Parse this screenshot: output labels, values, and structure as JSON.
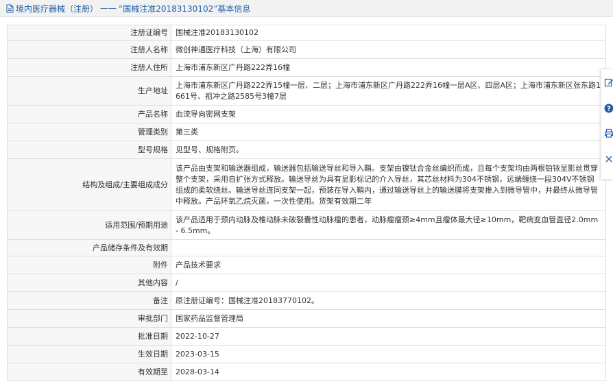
{
  "header": {
    "section": "境内医疗器械（注册）",
    "separator": "——",
    "title": "“国械注准20183130102”基本信息"
  },
  "rows": [
    {
      "label": "注册证编号",
      "value": "国械注准20183130102"
    },
    {
      "label": "注册人名称",
      "value": "微创神通医疗科技（上海）有限公司"
    },
    {
      "label": "注册人住所",
      "value": "上海市浦东新区广丹路222弄16幢"
    },
    {
      "label": "生产地址",
      "value": "上海市浦东新区广丹路222弄15幢一层、二层；上海市浦东新区广丹路222弄16幢一层A区、四层A区；上海市浦东新区张东路1661号、祖冲之路2585号3幢7层"
    },
    {
      "label": "产品名称",
      "value": "血流导向密网支架"
    },
    {
      "label": "管理类别",
      "value": "第三类"
    },
    {
      "label": "型号规格",
      "value": "见型号、规格附页。"
    },
    {
      "label": "结构及组成/主要组成成分",
      "value": "该产品由支架和输送器组成，输送器包括输送导丝和导入鞘。支架由镍钛合金丝编织而成，且每个支架均由两根铂铱显影丝贯穿整个支架，采用自扩张方式释放。输送导丝为具有显影标记的介入导丝，其芯丝材料为304不锈钢，远端缠绕一段304V不锈钢组成的柔软绕丝。输送导丝连同支架一起，预装在导入鞘内，通过输送导丝上的输送膜将支架推入到微导管中，并最终从微导管中释放。产品环氧乙烷灭菌，一次性使用。货架有效期二年"
    },
    {
      "label": "适用范围/预期用途",
      "value": "该产品适用于颈内动脉及椎动脉未破裂囊性动脉瘤的患者，动脉瘤瘤颈≥4mm且瘤体最大径≥10mm，靶病变血管直径2.0mm - 6.5mm。"
    },
    {
      "label": "产品储存条件及有效期",
      "value": ""
    },
    {
      "label": "附件",
      "value": "产品技术要求"
    },
    {
      "label": "其他内容",
      "value": "/"
    },
    {
      "label": "备注",
      "value": "原注册证编号：国械注准20183770102。"
    },
    {
      "label": "审批部门",
      "value": "国家药品监督管理局"
    },
    {
      "label": "批准日期",
      "value": "2022-10-27"
    },
    {
      "label": "生效日期",
      "value": "2023-03-15"
    },
    {
      "label": "有效期至",
      "value": "2028-03-14"
    }
  ],
  "side_tools": [
    {
      "name": "edit-icon"
    },
    {
      "name": "help-icon"
    },
    {
      "name": "print-icon"
    },
    {
      "name": "close-icon"
    }
  ],
  "colors": {
    "header_text": "#1f5fa8",
    "label_bg": "#f7f7f7",
    "border": "#dddddd"
  }
}
